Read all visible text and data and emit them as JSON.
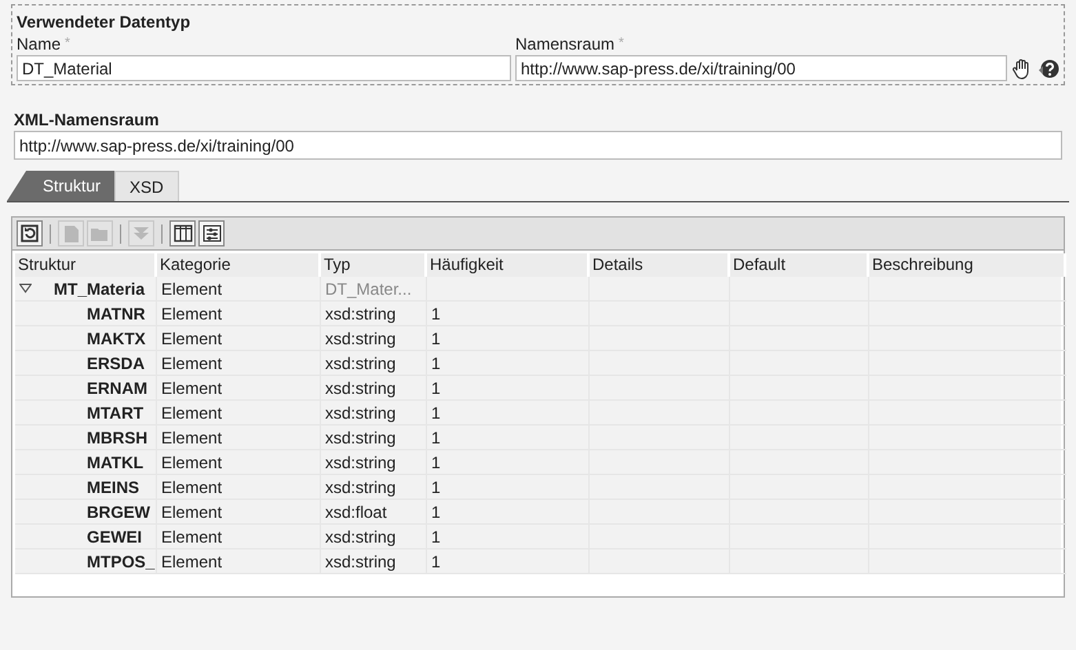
{
  "header": {
    "title": "Verwendeter Datentyp",
    "fields": [
      {
        "label": "Name",
        "required_mark": "*",
        "value": "DT_Material"
      },
      {
        "label": "Namensraum",
        "required_mark": "*",
        "value": "http://www.sap-press.de/xi/training/00"
      }
    ]
  },
  "xml_namespace": {
    "label": "XML-Namensraum",
    "value": "http://www.sap-press.de/xi/training/00"
  },
  "tabs": [
    {
      "label": "Struktur",
      "selected": true
    },
    {
      "label": "XSD",
      "selected": false
    }
  ],
  "toolbar": [
    {
      "kind": "refresh",
      "disabled": false
    },
    {
      "kind": "new",
      "disabled": true
    },
    {
      "kind": "open",
      "disabled": true
    },
    {
      "kind": "down",
      "disabled": true
    },
    {
      "kind": "columns",
      "disabled": false
    },
    {
      "kind": "settings",
      "disabled": false
    }
  ],
  "table": {
    "columns": [
      "Struktur",
      "Kategorie",
      "Typ",
      "Häufigkeit",
      "Details",
      "Default",
      "Beschreibung"
    ],
    "rows": [
      {
        "name": "MT_Materia",
        "category": "Element",
        "type": "DT_Mater...",
        "type_greyed": true,
        "occurrence": "",
        "expanded": true,
        "children": [
          {
            "name": "MATNR",
            "category": "Element",
            "type": "xsd:string",
            "occurrence": "1"
          },
          {
            "name": "MAKTX",
            "category": "Element",
            "type": "xsd:string",
            "occurrence": "1"
          },
          {
            "name": "ERSDA",
            "category": "Element",
            "type": "xsd:string",
            "occurrence": "1"
          },
          {
            "name": "ERNAM",
            "category": "Element",
            "type": "xsd:string",
            "occurrence": "1"
          },
          {
            "name": "MTART",
            "category": "Element",
            "type": "xsd:string",
            "occurrence": "1"
          },
          {
            "name": "MBRSH",
            "category": "Element",
            "type": "xsd:string",
            "occurrence": "1"
          },
          {
            "name": "MATKL",
            "category": "Element",
            "type": "xsd:string",
            "occurrence": "1"
          },
          {
            "name": "MEINS",
            "category": "Element",
            "type": "xsd:string",
            "occurrence": "1"
          },
          {
            "name": "BRGEW",
            "category": "Element",
            "type": "xsd:float",
            "occurrence": "1"
          },
          {
            "name": "GEWEI",
            "category": "Element",
            "type": "xsd:string",
            "occurrence": "1"
          },
          {
            "name": "MTPOS_",
            "category": "Element",
            "type": "xsd:string",
            "occurrence": "1"
          }
        ]
      }
    ]
  }
}
